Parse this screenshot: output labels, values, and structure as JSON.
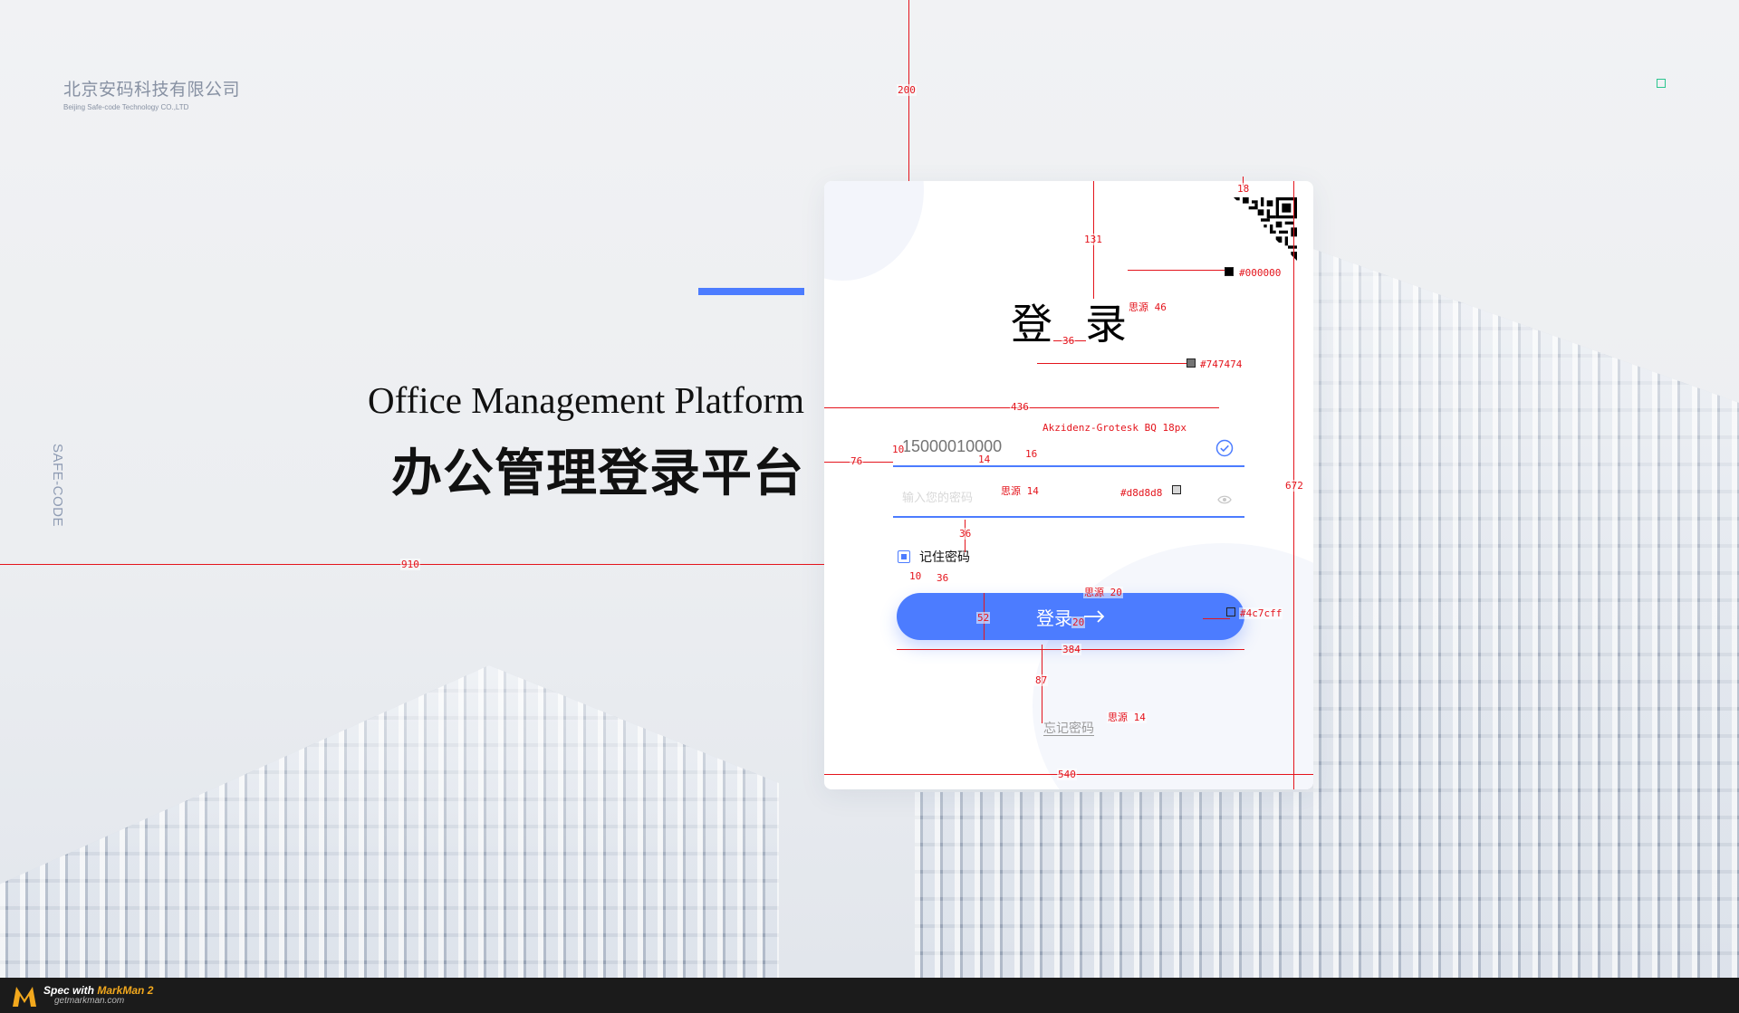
{
  "company": {
    "name_cn": "北京安码科技有限公司",
    "name_en": "Beijing Safe-code Technology CO.,LTD"
  },
  "side_label": "SAFE-CODE",
  "hero": {
    "title_en": "Office Management Platform",
    "title_cn": "办公管理登录平台"
  },
  "login": {
    "title": "登录",
    "username_value": "15000010000",
    "password_placeholder": "输入您的密码",
    "remember_label": "记住密码",
    "remember_checked": true,
    "submit_label": "登录",
    "forgot_label": "忘记密码"
  },
  "icons": {
    "qr": "qr-code-icon",
    "check": "check-circle-icon",
    "eye": "eye-icon",
    "arrow": "arrow-right-icon"
  },
  "colors": {
    "accent": "#4c7cff",
    "title_text": "#000000",
    "input_text": "#747474",
    "placeholder": "#d8d8d8"
  },
  "annotations": {
    "top_margin": "200",
    "qr_offset": "18",
    "title_offset": "131",
    "title_color": "#000000",
    "title_font": "思源 46",
    "title_spacing": "36",
    "input_color": "#747474",
    "input_width": "436",
    "input_font": "Akzidenz-Grotesk BQ  18px",
    "input_left": "76",
    "input_pad": "10",
    "input_font_size": "16",
    "input_gap": "14",
    "placeholder_font": "思源 14",
    "placeholder_color": "#d8d8d8",
    "remember_gap": "36",
    "card_height": "672",
    "left_width": "910",
    "checkbox_gap": "10",
    "checkbox_label_gap": "36",
    "button_font": "思源 20",
    "button_color": "#4c7cff",
    "button_height": "52",
    "button_text_size": "20",
    "button_width": "384",
    "forgot_gap": "87",
    "forgot_font": "思源 14",
    "card_width": "540"
  },
  "footer": {
    "spec_prefix": "Spec with ",
    "brand": "MarkMan 2",
    "url": "getmarkman.com"
  }
}
